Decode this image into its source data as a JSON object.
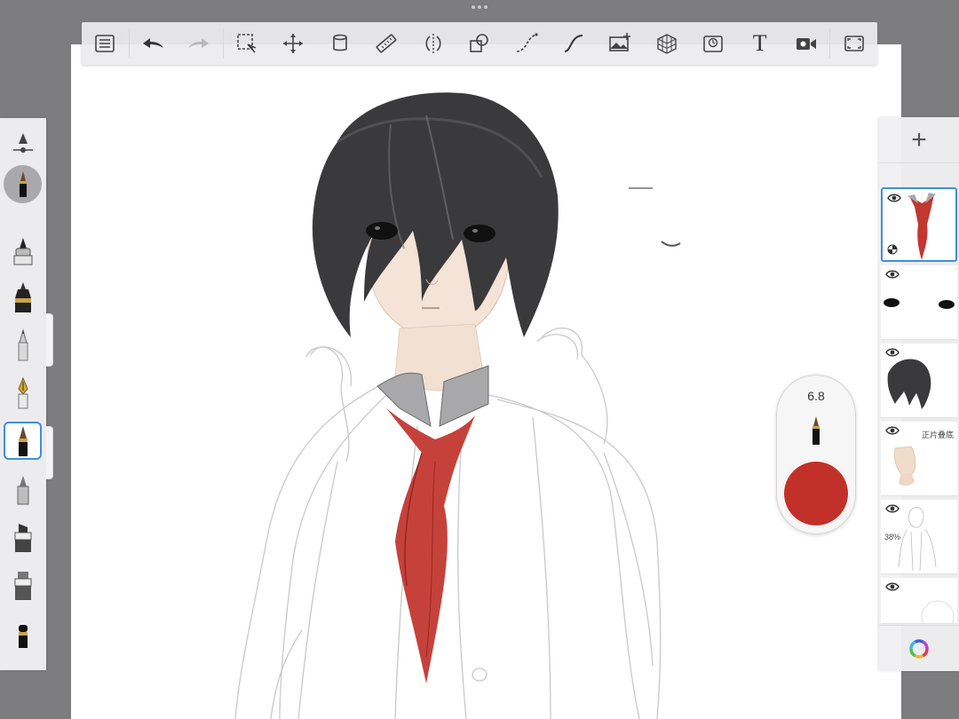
{
  "toolbar": {
    "icons": [
      "brush-library",
      "undo",
      "redo",
      "selection",
      "transform",
      "fill",
      "ruler",
      "symmetry",
      "shapes",
      "steady-stroke",
      "predictive-stroke",
      "import-image",
      "perspective-guide",
      "flipbook",
      "text",
      "timelapse",
      "fullscreen"
    ],
    "text_tool_glyph": "T"
  },
  "brush_palette": {
    "brushes": [
      "airbrush",
      "ink-pen",
      "technical-pen",
      "pencil",
      "fountain-pen",
      "paintbrush",
      "marker",
      "chisel-marker",
      "flat-marker",
      "eraser"
    ],
    "selected": "paintbrush"
  },
  "puck": {
    "brush_size": "6.8",
    "color": "#c1312a"
  },
  "layers": {
    "add_label": "+",
    "items": [
      {
        "name": "tie",
        "active": true,
        "blend_mode": "",
        "opacity": ""
      },
      {
        "name": "eyes",
        "active": false,
        "blend_mode": "",
        "opacity": ""
      },
      {
        "name": "hair",
        "active": false,
        "blend_mode": "",
        "opacity": ""
      },
      {
        "name": "skin",
        "active": false,
        "blend_mode": "正片叠底",
        "opacity": ""
      },
      {
        "name": "sketch",
        "active": false,
        "blend_mode": "",
        "opacity": "38%"
      },
      {
        "name": "background",
        "active": false,
        "blend_mode": "",
        "opacity": ""
      }
    ]
  },
  "colors": {
    "accent": "#3d8fe0",
    "primary": "#c1312a",
    "chrome": "#7d7d80"
  }
}
